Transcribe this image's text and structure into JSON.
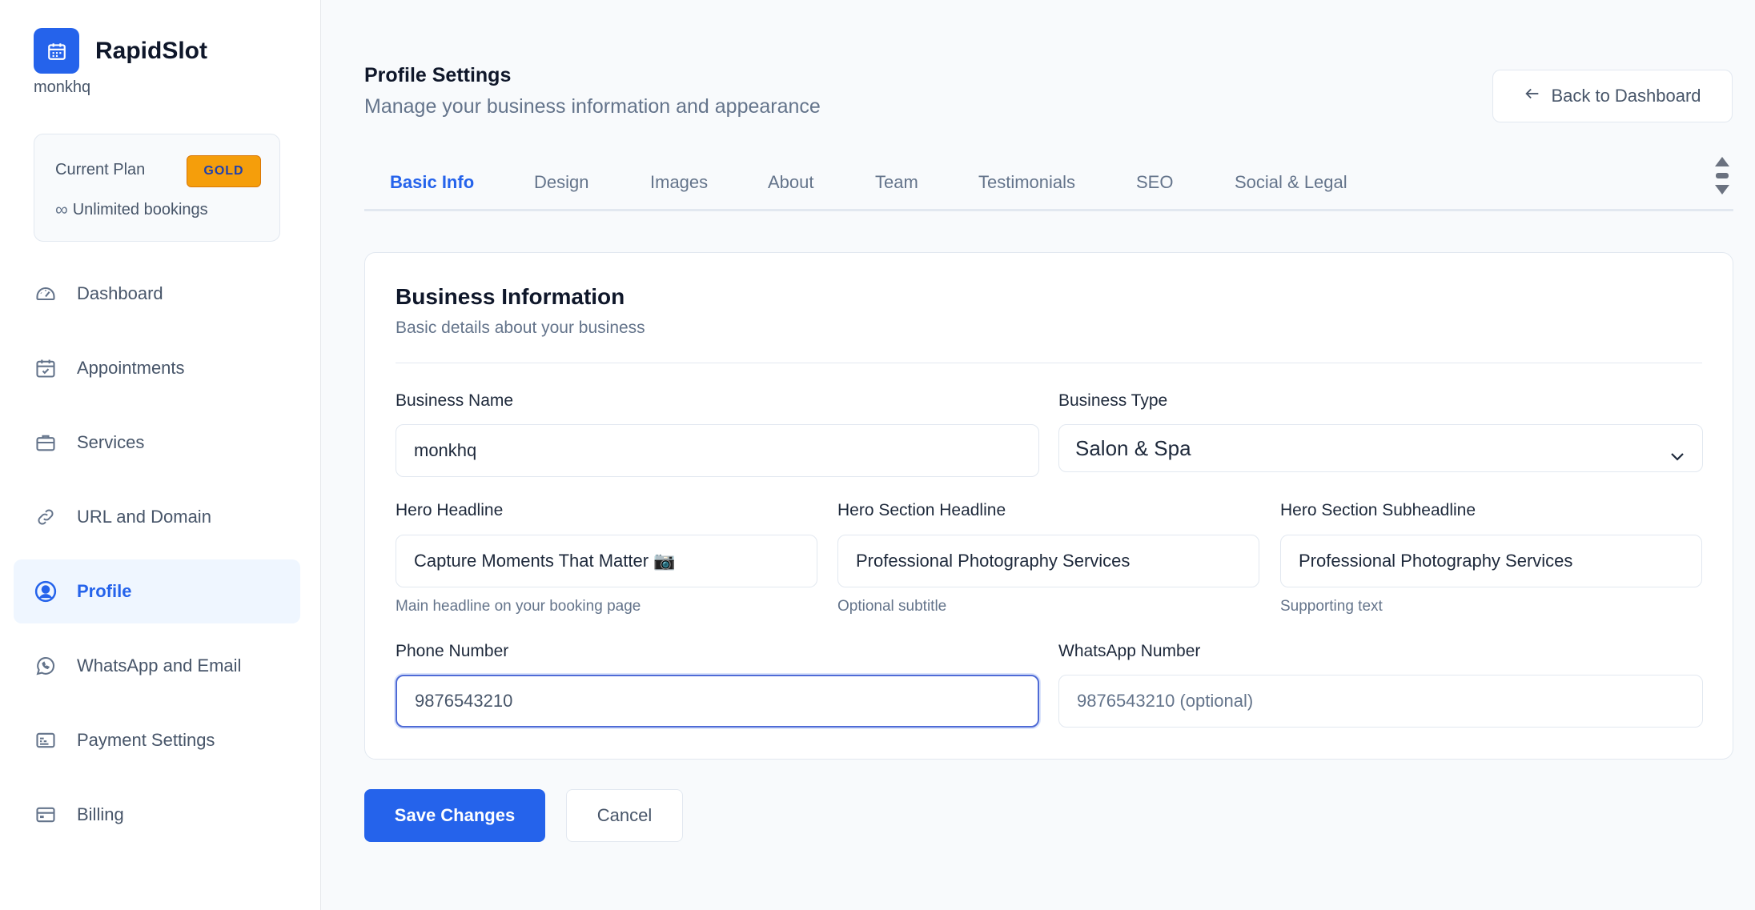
{
  "brand": {
    "name": "RapidSlot",
    "username": "monkhq"
  },
  "plan": {
    "label": "Current Plan",
    "badge": "GOLD",
    "infinity": "∞",
    "detail": "Unlimited bookings"
  },
  "nav": {
    "items": [
      {
        "label": "Dashboard",
        "icon": "dashboard-gauge-icon"
      },
      {
        "label": "Appointments",
        "icon": "calendar-check-icon"
      },
      {
        "label": "Services",
        "icon": "briefcase-icon"
      },
      {
        "label": "URL and Domain",
        "icon": "link-icon"
      },
      {
        "label": "Profile",
        "icon": "user-circle-icon",
        "active": true
      },
      {
        "label": "WhatsApp and Email",
        "icon": "whatsapp-icon"
      },
      {
        "label": "Payment Settings",
        "icon": "payment-card-icon"
      },
      {
        "label": "Billing",
        "icon": "credit-card-icon"
      }
    ]
  },
  "header": {
    "title": "Profile Settings",
    "subtitle": "Manage your business information and appearance",
    "back_label": "Back to Dashboard"
  },
  "tabs": [
    {
      "label": "Basic Info",
      "active": true
    },
    {
      "label": "Design"
    },
    {
      "label": "Images"
    },
    {
      "label": "About"
    },
    {
      "label": "Team"
    },
    {
      "label": "Testimonials"
    },
    {
      "label": "SEO"
    },
    {
      "label": "Social & Legal"
    }
  ],
  "card": {
    "title": "Business Information",
    "subtitle": "Basic details about your business"
  },
  "form": {
    "business_name": {
      "label": "Business Name",
      "value": "monkhq"
    },
    "business_type": {
      "label": "Business Type",
      "value": "Salon & Spa"
    },
    "hero_headline": {
      "label": "Hero Headline",
      "value": "Capture Moments That Matter 📷",
      "helper": "Main headline on your booking page"
    },
    "hero_section_headline": {
      "label": "Hero Section Headline",
      "value": "Professional Photography Services",
      "helper": "Optional subtitle"
    },
    "hero_section_subheadline": {
      "label": "Hero Section Subheadline",
      "value": "Professional Photography Services",
      "helper": "Supporting text"
    },
    "phone": {
      "label": "Phone Number",
      "value": "9876543210"
    },
    "whatsapp": {
      "label": "WhatsApp Number",
      "placeholder": "9876543210 (optional)"
    }
  },
  "actions": {
    "save_label": "Save Changes",
    "cancel_label": "Cancel"
  },
  "colors": {
    "accent": "#2563eb",
    "badge": "#f59e0b",
    "active_bg": "#eff6ff"
  }
}
